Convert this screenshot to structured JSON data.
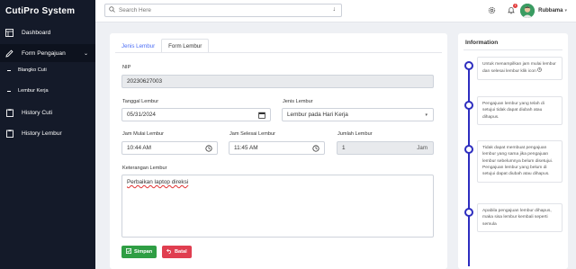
{
  "app": {
    "brand": "CutiPro System"
  },
  "sidebar": {
    "items": [
      {
        "label": "Dashboard",
        "icon": "dashboard-icon"
      },
      {
        "label": "Form Pengajuan",
        "icon": "pen-icon",
        "active": true
      },
      {
        "label": "Blangko Cuti",
        "sub": true
      },
      {
        "label": "Lembur Kerja",
        "sub": true
      },
      {
        "label": "History Cuti",
        "icon": "clipboard-icon"
      },
      {
        "label": "History Lembur",
        "icon": "clipboard-icon"
      }
    ]
  },
  "topbar": {
    "search_placeholder": "Search Here",
    "notification_count": "1",
    "username": "Rubbama"
  },
  "tabs": [
    {
      "label": "Jenis Lembur"
    },
    {
      "label": "Form Lembur",
      "active": true
    }
  ],
  "form": {
    "nip_label": "NIP",
    "nip_value": "20230627003",
    "tanggal_label": "Tanggal Lembur",
    "tanggal_value": "05/31/2024",
    "jenis_label": "Jenis Lembur",
    "jenis_value": "Lembur pada Hari Kerja",
    "jam_mulai_label": "Jam Mulai Lembur",
    "jam_mulai_value": "10:44 AM",
    "jam_selesai_label": "Jam Selesai Lembur",
    "jam_selesai_value": "11:45 AM",
    "jumlah_label": "Jumlah Lembur",
    "jumlah_value": "1",
    "jumlah_suffix": "Jam",
    "keterangan_label": "Keterangan Lembur",
    "keterangan_value": "Perbaikan laptop direksi",
    "save_label": "Simpan",
    "cancel_label": "Batal"
  },
  "info": {
    "title": "Information",
    "items": [
      {
        "text": "Untuk menampilkan jam mulai lembur dan selesai lembur klik icon"
      },
      {
        "text": "Pengajuan lembur yang telah di setujui tidak dapat diubah atau dihapus."
      },
      {
        "text": "Tidak dapat membuat pengajuan lembur yang sama jika pengajuan lembur sebelumnya belum disetujui. Pengajuan lembur yang belum di setujui dapat diubah atau dihapus."
      },
      {
        "text": "Apabila pengajuan lembur dihapus, maka sisa lembur kembali seperti semula"
      }
    ]
  },
  "colors": {
    "sidebar_bg": "#141a29",
    "accent": "#2d2dbf",
    "save": "#2f9e44",
    "cancel": "#e03e50"
  }
}
